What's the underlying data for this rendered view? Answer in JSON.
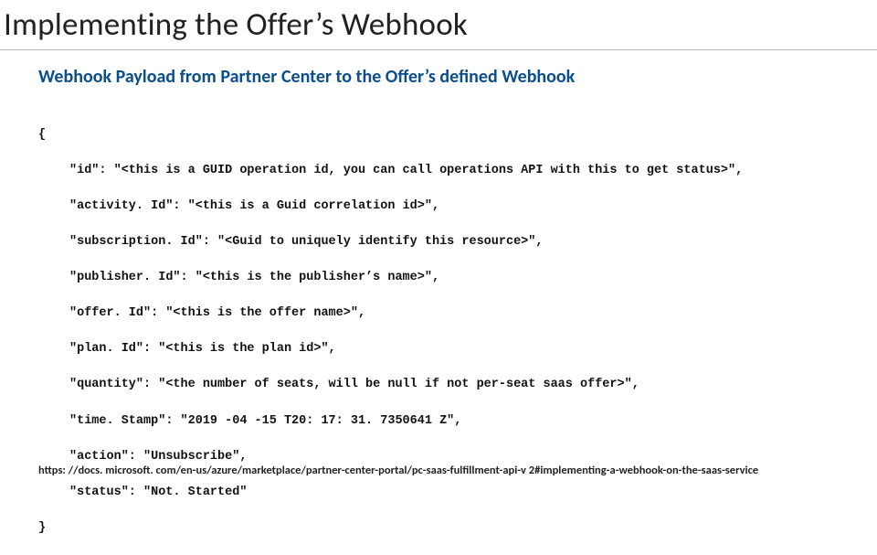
{
  "title": "Implementing the Offer’s Webhook",
  "subtitle": "Webhook Payload from Partner Center to the Offer’s defined Webhook",
  "code": {
    "open": "{",
    "lines": [
      "\"id\": \"<this is a GUID operation id, you can call operations API with this to get status>\",",
      "\"activity. Id\": \"<this is a Guid correlation id>\",",
      "\"subscription. Id\": \"<Guid to uniquely identify this resource>\",",
      "\"publisher. Id\": \"<this is the publisher’s name>\",",
      "\"offer. Id\": \"<this is the offer name>\",",
      "\"plan. Id\": \"<this is the plan id>\",",
      "\"quantity\": \"<the number of seats, will be null if not per-seat saas offer>\",",
      "\"time. Stamp\": \"2019 -04 -15 T20: 17: 31. 7350641 Z\",",
      "\"action\": \"Unsubscribe\",",
      "\"status\": \"Not. Started\""
    ],
    "close": "}"
  },
  "footer_link": "https: //docs. microsoft. com/en-us/azure/marketplace/partner-center-portal/pc-saas-fulfillment-api-v 2#implementing-a-webhook-on-the-saas-service"
}
